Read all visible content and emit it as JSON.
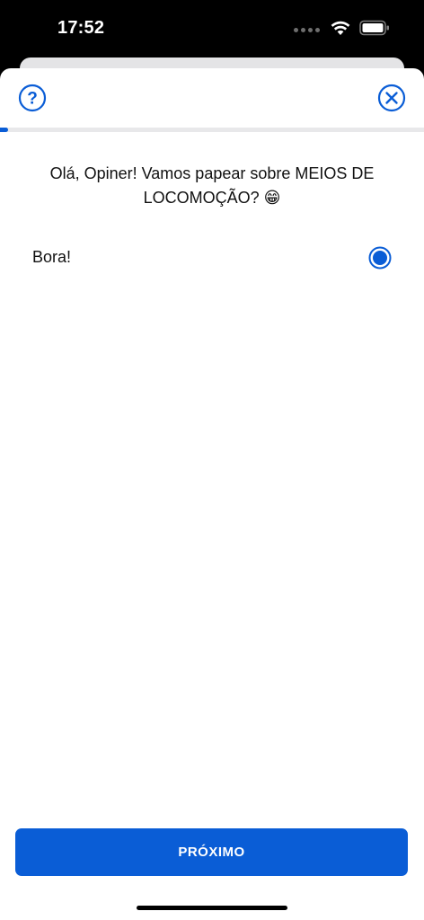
{
  "status_bar": {
    "time": "17:52",
    "icons": [
      "signal-icon",
      "wifi-icon",
      "battery-icon"
    ]
  },
  "header": {
    "help_icon": "question-circle-icon",
    "close_icon": "x-circle-icon"
  },
  "progress": {
    "fraction": 0.02
  },
  "question": {
    "text": "Olá, Opiner! Vamos papear sobre MEIOS DE LOCOMOÇÃO? 😁"
  },
  "options": [
    {
      "label": "Bora!",
      "selected": true
    }
  ],
  "footer": {
    "next_label": "PRÓXIMO"
  },
  "colors": {
    "accent": "#0a5dd6",
    "background": "#ffffff",
    "text": "#111111",
    "track": "#e8e8ea"
  }
}
